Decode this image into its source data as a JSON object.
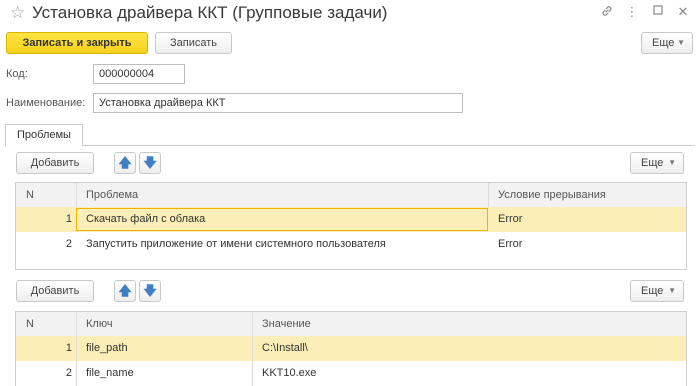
{
  "window": {
    "title": "Установка драйвера ККТ (Групповые задачи)",
    "icons": [
      "star-icon",
      "link-icon",
      "more-vert-icon",
      "maximize-icon",
      "close-icon"
    ]
  },
  "toolbar": {
    "save_close_label": "Записать и закрыть",
    "save_label": "Записать",
    "more_label": "Еще"
  },
  "form": {
    "code_label": "Код:",
    "code_value": "000000004",
    "name_label": "Наименование:",
    "name_value": "Установка драйвера ККТ"
  },
  "tabs": [
    {
      "label": "Проблемы",
      "active": true
    }
  ],
  "problems": {
    "add_label": "Добавить",
    "more_label": "Еще",
    "columns": [
      "N",
      "Проблема",
      "Условие прерывания"
    ],
    "rows": [
      {
        "n": "1",
        "problem": "Скачать файл с облака",
        "condition": "Error",
        "selected": true
      },
      {
        "n": "2",
        "problem": "Запустить приложение от имени системного пользователя",
        "condition": "Error",
        "selected": false
      }
    ]
  },
  "params": {
    "add_label": "Добавить",
    "more_label": "Еще",
    "columns": [
      "N",
      "Ключ",
      "Значение"
    ],
    "rows": [
      {
        "n": "1",
        "key": "file_path",
        "value": "C:\\Install\\",
        "selected": true
      },
      {
        "n": "2",
        "key": "file_name",
        "value": "KKT10.exe",
        "selected": false
      }
    ]
  },
  "colors": {
    "accent_yellow": "#f7d21b",
    "selected_row": "#fbeeb7",
    "arrow_blue": "#3f7fc4"
  }
}
